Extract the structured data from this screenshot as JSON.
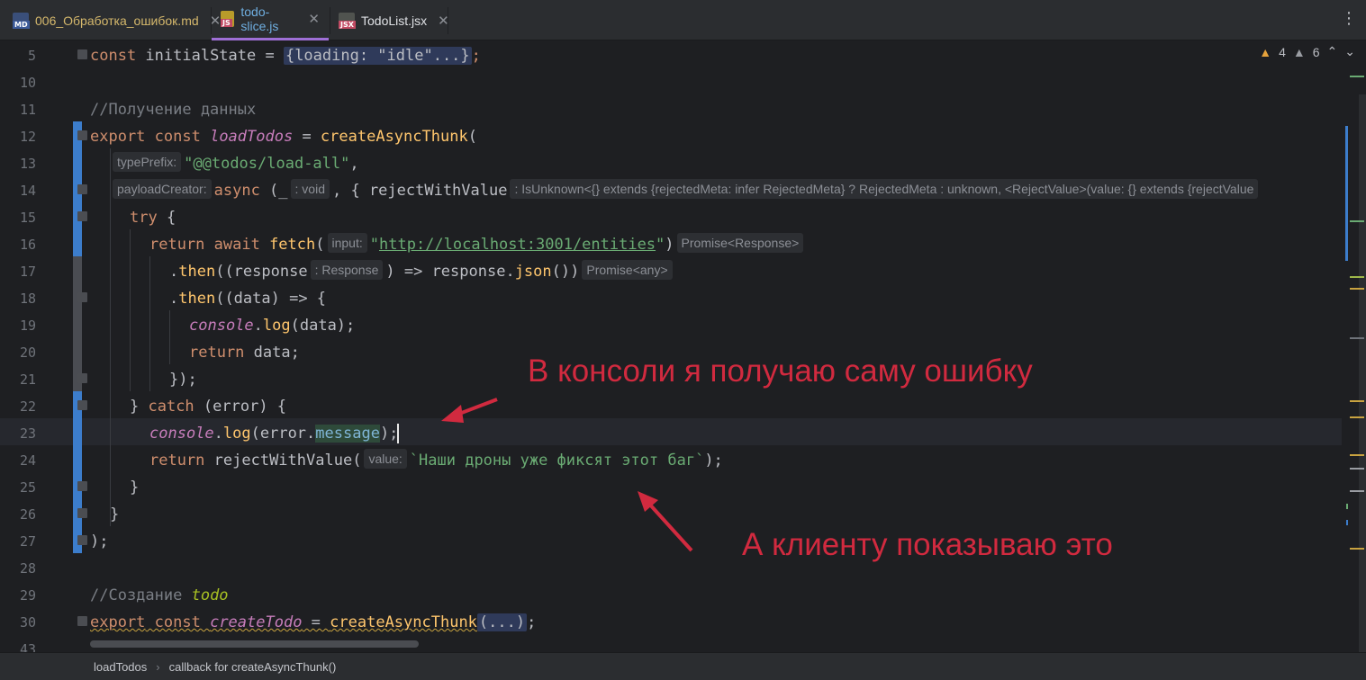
{
  "tabs": [
    {
      "label": "006_Обработка_ошибок.md",
      "icon": "markdown-file-icon",
      "badge": "MD"
    },
    {
      "label": "todo-slice.js",
      "icon": "javascript-file-icon",
      "badge": "JS",
      "active": true
    },
    {
      "label": "TodoList.jsx",
      "icon": "jsx-file-icon",
      "badge": "JSX"
    }
  ],
  "close_glyph": "✕",
  "menu_glyph": "⋮",
  "inspections": {
    "warnings": "4",
    "weak_warnings": "6"
  },
  "line_numbers": [
    "5",
    "10",
    "11",
    "12",
    "13",
    "14",
    "15",
    "16",
    "17",
    "18",
    "19",
    "20",
    "21",
    "22",
    "23",
    "24",
    "25",
    "26",
    "27",
    "28",
    "29",
    "30",
    "43"
  ],
  "code": {
    "l5_kw": "const",
    "l5_name": " initialState = ",
    "l5_fold": "{loading: \"idle\"...}",
    "l5_end": ";",
    "l11": "//Получение данных",
    "l12_kw1": "export",
    "l12_kw2": " const ",
    "l12_name": "loadTodos",
    "l12_eq": " = ",
    "l12_fn": "createAsyncThunk",
    "l12_paren": "(",
    "l13_hint": "typePrefix:",
    "l13_str": "\"@@todos/load-all\"",
    "l13_comma": ",",
    "l14_hint": "payloadCreator:",
    "l14_kw": "async",
    "l14_p1": " (_",
    "l14_hint2": ": void",
    "l14_p2": ", { rejectWithValue",
    "l14_hint3": ": IsUnknown<{} extends {rejectedMeta: infer RejectedMeta} ? RejectedMeta : unknown, <RejectValue>(value: {} extends {rejectValue",
    "l15_kw": "try",
    "l15_rest": " {",
    "l16_kw": "return await ",
    "l16_fn": "fetch",
    "l16_paren": "(",
    "l16_hint": "input:",
    "l16_q1": "\"",
    "l16_url": "http://localhost:3001/entities",
    "l16_q2": "\"",
    "l16_close": ")",
    "l16_hint2": "Promise<Response>",
    "l17_dot": ".",
    "l17_fn": "then",
    "l17_a": "((response",
    "l17_hint": ": Response",
    "l17_b": ") => response.",
    "l17_fn2": "json",
    "l17_c": "())",
    "l17_hint2": "Promise<any>",
    "l18_dot": ".",
    "l18_fn": "then",
    "l18_rest": "((data) => {",
    "l19_console": "console",
    "l19_dot": ".",
    "l19_fn": "log",
    "l19_rest": "(data);",
    "l20_kw": "return",
    "l20_rest": " data;",
    "l21": "});",
    "l22_a": "} ",
    "l22_kw": "catch",
    "l22_b": " (error) {",
    "l23_console": "console",
    "l23_dot": ".",
    "l23_fn": "log",
    "l23_a": "(error.",
    "l23_prop": "message",
    "l23_b": ");",
    "l24_kw": "return",
    "l24_fn": " rejectWithValue",
    "l24_paren": "(",
    "l24_hint": "value:",
    "l24_str": "`Наши дроны уже фиксят этот баг`",
    "l24_end": ");",
    "l25": "}",
    "l26": "}",
    "l27": ");",
    "l29_cmt": "//Создание ",
    "l29_todo": "todo",
    "l30_kw1": "export",
    "l30_kw2": " const ",
    "l30_name": "createTodo",
    "l30_eq": " = ",
    "l30_fn": "createAsyncThunk",
    "l30_fold": "(...)",
    "l30_end": ";"
  },
  "annotations": {
    "top": "В консоли я получаю саму ошибку",
    "bottom": "А клиенту показываю это",
    "color": "#d12a3f"
  },
  "breadcrumbs": [
    "loadTodos",
    "callback for createAsyncThunk()"
  ],
  "breadcrumb_sep": "›"
}
